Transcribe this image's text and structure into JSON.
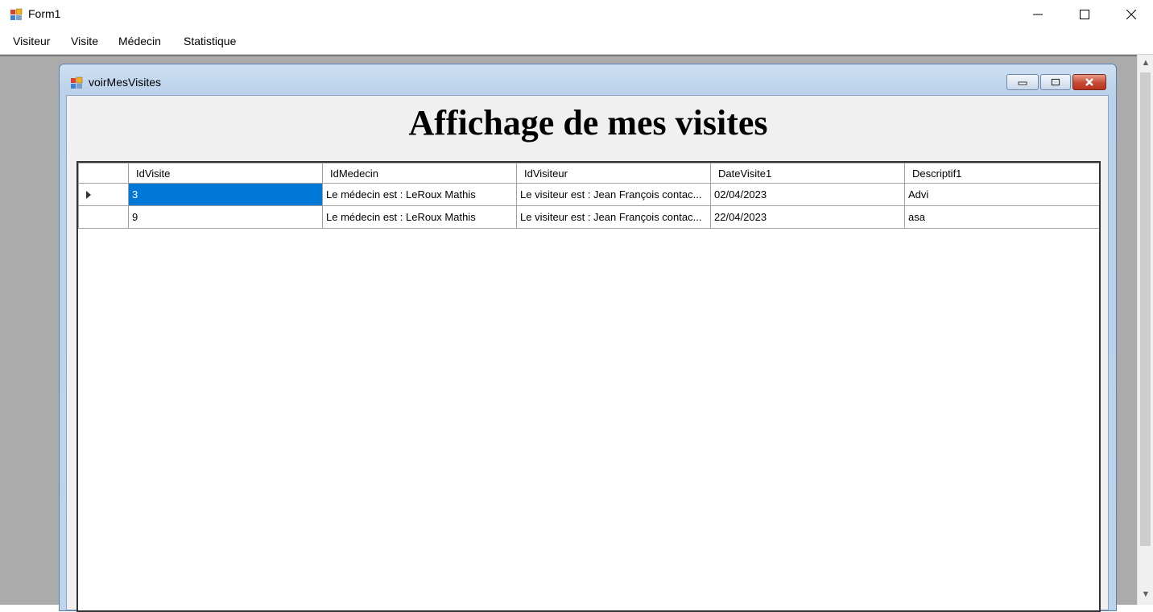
{
  "window": {
    "title": "Form1"
  },
  "menu": {
    "items": [
      "Visiteur",
      "Visite",
      "Médecin",
      "Statistique"
    ]
  },
  "child": {
    "title": "voirMesVisites"
  },
  "heading": "Affichage de mes visites",
  "grid": {
    "columns": [
      "IdVisite",
      "IdMedecin",
      "IdVisiteur",
      "DateVisite1",
      "Descriptif1"
    ],
    "rows": [
      [
        "3",
        "Le médecin est : LeRoux Mathis",
        "Le visiteur est : Jean François contac...",
        "02/04/2023",
        "Advi"
      ],
      [
        "9",
        "Le médecin est : LeRoux Mathis",
        "Le visiteur est : Jean François contac...",
        "22/04/2023",
        "asa"
      ]
    ]
  },
  "colors": {
    "selection": "#0078d7",
    "mdi_background": "#ababab"
  }
}
